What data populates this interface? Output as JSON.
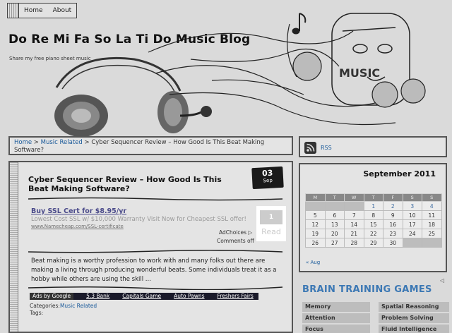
{
  "nav": {
    "items": [
      "Home",
      "About"
    ]
  },
  "site": {
    "title": "Do Re Mi Fa So La Ti Do Music Blog",
    "description": "Share my free piano sheet music",
    "header_word": "MUSIC"
  },
  "breadcrumb": {
    "home": "Home",
    "sep1": " > ",
    "category": "Music Related",
    "sep2": " > ",
    "current": "Cyber Sequencer Review – How Good Is This Beat Making Software?"
  },
  "rss": {
    "label": "RSS"
  },
  "post": {
    "title": "Cyber Sequencer Review – How Good Is This Beat Making Software?",
    "date_day": "03",
    "date_month": "Sep",
    "ad_title": "Buy SSL Cert for $8.95/yr",
    "ad_text": "Lowest Cost SSL w/ $10,000 Warranty Visit Now for Cheapest SSL offer!",
    "ad_url": "www.Namecheap.com/SSL-certificate",
    "adchoices": "AdChoices ▷",
    "comments": "Comments off",
    "read_count": "1",
    "read_label": "Read",
    "excerpt": "Beat making is a worthy profession to work with and many folks out there are making a living through producing wonderful beats. Some individuals treat it as a hobby while others are using the skill ...",
    "ads_by": "Ads by Google",
    "ad_links": [
      "5.3 Bank",
      "Capitals Game",
      "Auto Pawns",
      "Freshers Fairs"
    ],
    "categories_label": "Categories:",
    "category_link": "Music Related",
    "tags_label": "Tags:"
  },
  "calendar": {
    "title": "September 2011",
    "headers": [
      "M",
      "T",
      "W",
      "T",
      "F",
      "S",
      "S"
    ],
    "rows": [
      [
        "",
        "",
        "",
        "1",
        "2",
        "3",
        "4"
      ],
      [
        "5",
        "6",
        "7",
        "8",
        "9",
        "10",
        "11"
      ],
      [
        "12",
        "13",
        "14",
        "15",
        "16",
        "17",
        "18"
      ],
      [
        "19",
        "20",
        "21",
        "22",
        "23",
        "24",
        "25"
      ],
      [
        "26",
        "27",
        "28",
        "29",
        "30",
        "",
        ""
      ]
    ],
    "linked_days": [
      "1",
      "2",
      "3",
      "4"
    ],
    "prev": "« Aug"
  },
  "brain_ad": {
    "title": "BRAIN TRAINING GAMES",
    "choice": "◁",
    "items": [
      "Memory",
      "Spatial Reasoning",
      "Attention",
      "Problem Solving",
      "Focus",
      "Fluid Intelligence"
    ]
  },
  "colors": {
    "link": "#1a5a9a",
    "brain_accent": "#3c78b4",
    "panel": "#e4e4e4",
    "border": "#555555"
  }
}
